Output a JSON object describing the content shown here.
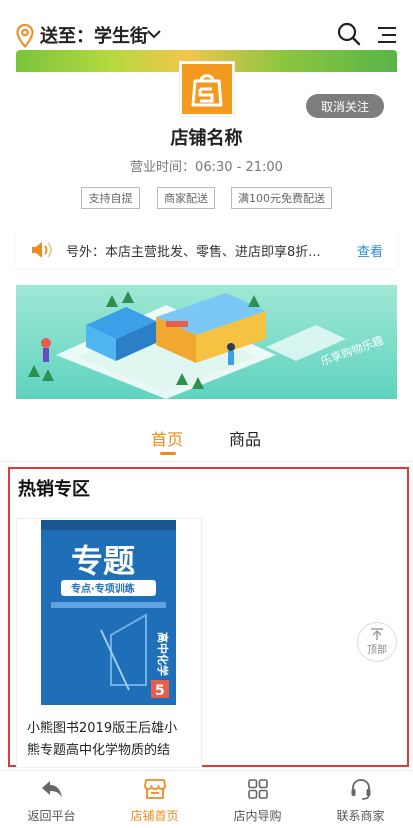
{
  "header": {
    "location_label": "送至：学生街"
  },
  "store": {
    "unfollow_label": "取消关注",
    "name": "店铺名称",
    "hours": "营业时间：06:30 - 21:00",
    "tags": [
      "支持自提",
      "商家配送",
      "满100元免费配送"
    ]
  },
  "notice": {
    "text": "号外：本店主营批发、零售、进店即享8折...",
    "more_label": "查看"
  },
  "promo": {
    "slogan": "乐享购物乐趣"
  },
  "tabs": [
    {
      "label": "首页",
      "active": true
    },
    {
      "label": "商品",
      "active": false
    }
  ],
  "hot_section": {
    "title": "热销专区",
    "products": [
      {
        "name": "小熊图书2019版王后雄小熊专题高中化学物质的结",
        "cover": {
          "title": "专题",
          "subtitle": "专点·专项训练",
          "series": "高中化学",
          "volume": "5"
        }
      }
    ]
  },
  "back_to_top_label": "顶部",
  "bottom_nav": [
    {
      "label": "返回平台",
      "icon": "back-arrow-icon",
      "active": false
    },
    {
      "label": "店铺首页",
      "icon": "store-icon",
      "active": true
    },
    {
      "label": "店内导购",
      "icon": "grid-icon",
      "active": false
    },
    {
      "label": "联系商家",
      "icon": "headset-icon",
      "active": false
    }
  ],
  "colors": {
    "accent": "#ee8a1e",
    "link": "#2a8be0",
    "highlight_border": "#e53935"
  }
}
